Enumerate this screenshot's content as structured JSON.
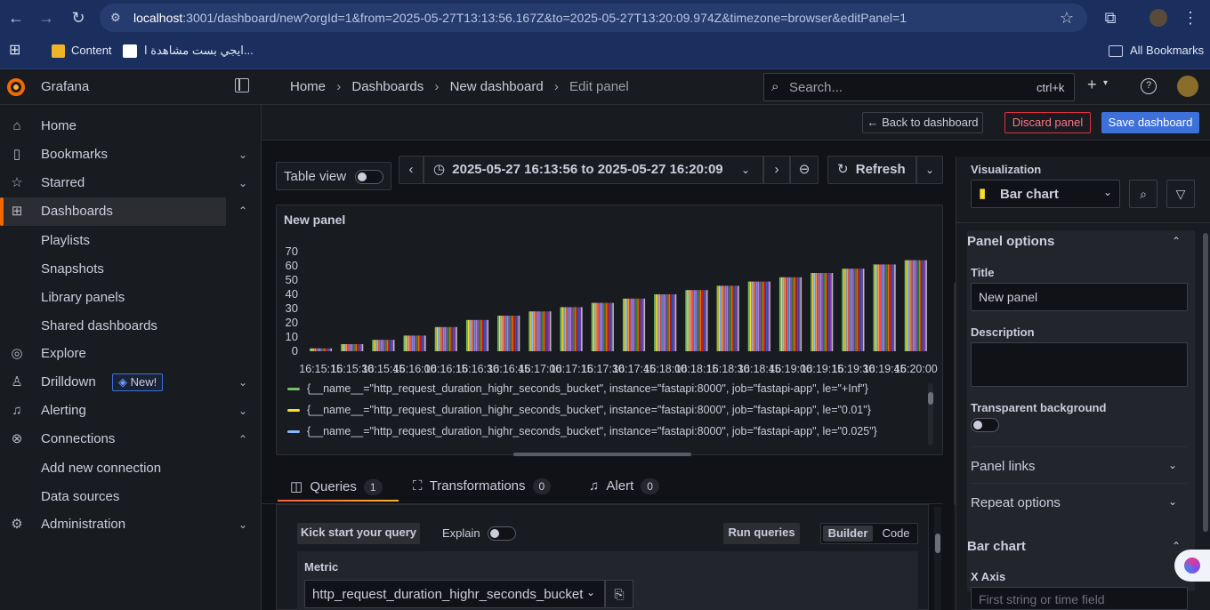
{
  "browser": {
    "url_host": "localhost",
    "url_rest": ":3001/dashboard/new?orgId=1&from=2025-05-27T13:13:56.167Z&to=2025-05-27T13:20:09.974Z&timezone=browser&editPanel=1",
    "bookmarks": [
      "Content",
      "ايجي بست مشاهدة ا..."
    ],
    "all_bookmarks": "All Bookmarks"
  },
  "app": {
    "name": "Grafana"
  },
  "breadcrumb": [
    "Home",
    "Dashboards",
    "New dashboard",
    "Edit panel"
  ],
  "search": {
    "placeholder": "Search...",
    "shortcut": "ctrl+k"
  },
  "actions": {
    "back": "Back to dashboard",
    "discard": "Discard panel",
    "save": "Save dashboard"
  },
  "sidebar": {
    "items": [
      {
        "label": "Home",
        "icon": "home-icon"
      },
      {
        "label": "Bookmarks",
        "icon": "bookmark-icon"
      },
      {
        "label": "Starred",
        "icon": "star-icon"
      },
      {
        "label": "Dashboards",
        "icon": "apps-icon"
      },
      {
        "label": "Explore",
        "icon": "compass-icon"
      },
      {
        "label": "Drilldown",
        "icon": "drilldown-icon",
        "badge": "New!"
      },
      {
        "label": "Alerting",
        "icon": "bell-icon"
      },
      {
        "label": "Connections",
        "icon": "connections-icon"
      },
      {
        "label": "Administration",
        "icon": "gear-icon"
      }
    ],
    "dashboards_sub": [
      "Playlists",
      "Snapshots",
      "Library panels",
      "Shared dashboards"
    ],
    "connections_sub": [
      "Add new connection",
      "Data sources"
    ]
  },
  "toolbar": {
    "table_view": "Table view",
    "time_range": "2025-05-27 16:13:56 to 2025-05-27 16:20:09",
    "refresh": "Refresh"
  },
  "panel": {
    "title": "New panel"
  },
  "chart_data": {
    "type": "bar",
    "categories": [
      "16:15:15",
      "16:15:30",
      "16:15:45",
      "16:16:00",
      "16:16:15",
      "16:16:30",
      "16:16:45",
      "16:17:00",
      "16:17:15",
      "16:17:30",
      "16:17:45",
      "16:18:00",
      "16:18:15",
      "16:18:30",
      "16:18:45",
      "16:19:00",
      "16:19:15",
      "16:19:30",
      "16:19:45",
      "16:20:00"
    ],
    "values": [
      2,
      5,
      8,
      11,
      17,
      22,
      25,
      28,
      31,
      34,
      37,
      40,
      43,
      46,
      49,
      52,
      55,
      58,
      61,
      64
    ],
    "y_ticks": [
      "0",
      "10",
      "20",
      "30",
      "40",
      "50",
      "60",
      "70"
    ],
    "ylim": [
      0,
      70
    ],
    "bar_colors": [
      "#73bf69",
      "#fade2a",
      "#8ab8ff",
      "#ff9830",
      "#f2495c",
      "#5794f2",
      "#b877d9",
      "#705da0",
      "#37872d",
      "#fa6400",
      "#c4162a",
      "#1f60c4",
      "#8f3bb8",
      "#bbbbbb"
    ],
    "legend": [
      {
        "label": "{__name__=\"http_request_duration_highr_seconds_bucket\", instance=\"fastapi:8000\", job=\"fastapi-app\", le=\"+Inf\"}",
        "color": "#73bf69"
      },
      {
        "label": "{__name__=\"http_request_duration_highr_seconds_bucket\", instance=\"fastapi:8000\", job=\"fastapi-app\", le=\"0.01\"}",
        "color": "#fade2a"
      },
      {
        "label": "{__name__=\"http_request_duration_highr_seconds_bucket\", instance=\"fastapi:8000\", job=\"fastapi-app\", le=\"0.025\"}",
        "color": "#8ab8ff"
      }
    ]
  },
  "tabs": [
    {
      "label": "Queries",
      "count": "1"
    },
    {
      "label": "Transformations",
      "count": "0"
    },
    {
      "label": "Alert",
      "count": "0"
    }
  ],
  "query": {
    "kick_start": "Kick start your query",
    "explain": "Explain",
    "run": "Run queries",
    "builder": "Builder",
    "code": "Code",
    "metric_label": "Metric",
    "metric_value": "http_request_duration_highr_seconds_bucket"
  },
  "options": {
    "visualization_label": "Visualization",
    "visualization": "Bar chart",
    "panel_options": "Panel options",
    "title_label": "Title",
    "title_value": "New panel",
    "description_label": "Description",
    "transparent_label": "Transparent background",
    "panel_links": "Panel links",
    "repeat_options": "Repeat options",
    "bar_chart_section": "Bar chart",
    "x_axis_label": "X Axis",
    "x_axis_placeholder": "First string or time field"
  }
}
